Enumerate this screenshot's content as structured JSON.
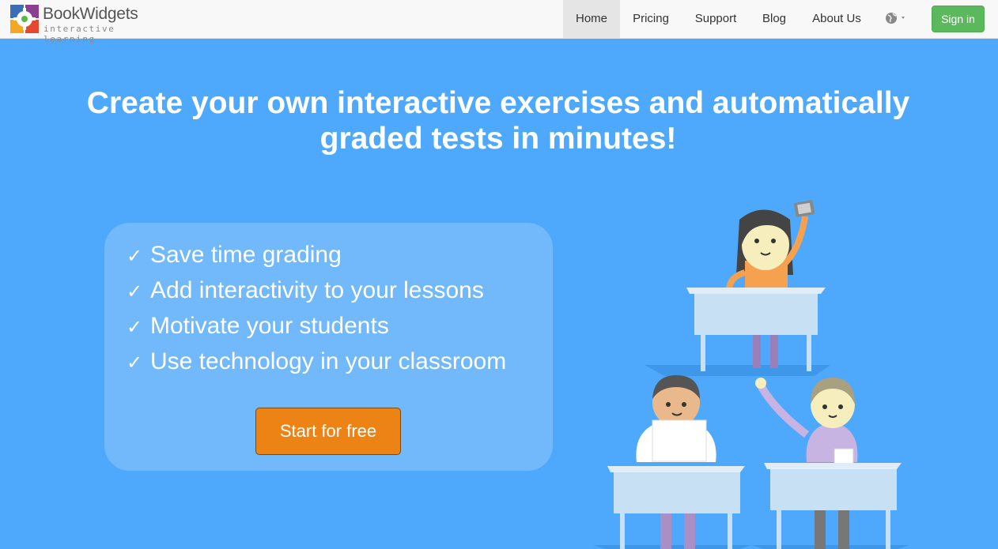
{
  "brand": {
    "name": "BookWidgets",
    "tagline": "interactive learning",
    "colors": [
      "#3a6fb5",
      "#8a3f8f",
      "#e5472f",
      "#f5a623",
      "#58b947"
    ]
  },
  "nav": {
    "items": [
      {
        "label": "Home",
        "active": true
      },
      {
        "label": "Pricing",
        "active": false
      },
      {
        "label": "Support",
        "active": false
      },
      {
        "label": "Blog",
        "active": false
      },
      {
        "label": "About Us",
        "active": false
      }
    ],
    "language_icon": "globe-icon",
    "signin_label": "Sign in"
  },
  "hero": {
    "headline_line1": "Create your own interactive exercises and automatically",
    "headline_line2": "graded tests in minutes!",
    "check_glyph": "✓",
    "features": [
      "Save time grading",
      "Add interactivity to your lessons",
      "Motivate your students",
      "Use technology in your classroom"
    ],
    "cta_label": "Start for free"
  },
  "colors": {
    "background": "#4ea8fb",
    "signin": "#5cb85c",
    "cta": "#ee8315",
    "navbar": "#f8f8f8"
  }
}
